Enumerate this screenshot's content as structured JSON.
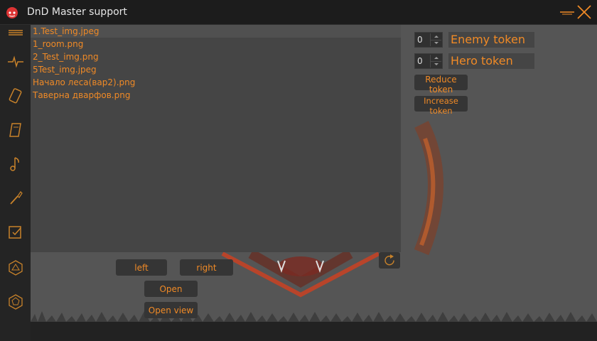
{
  "window": {
    "title": "DnD Master support"
  },
  "sidebar": {
    "icons": [
      "list-icon",
      "pulse-icon",
      "card-icon",
      "scroll-icon",
      "music-icon",
      "brush-icon",
      "checklist-icon",
      "d20-icon",
      "d12-icon"
    ]
  },
  "files": [
    "1.Test_img.jpeg",
    "1_room.png",
    "2_Test_img.png",
    "5Test_img.jpeg",
    "Начало леса(вар2).png",
    "Таверна дварфов.png"
  ],
  "buttons": {
    "left": "left",
    "right": "right",
    "open": "Open",
    "open_view": "Open view",
    "reduce_token": "Reduce token",
    "increase_token": "Increase token"
  },
  "tokens": {
    "enemy_value": "0",
    "enemy_label": "Enemy token",
    "hero_value": "0",
    "hero_label": "Hero token"
  },
  "colors": {
    "accent": "#f08a26",
    "background": "#555555",
    "panel": "#454545"
  }
}
